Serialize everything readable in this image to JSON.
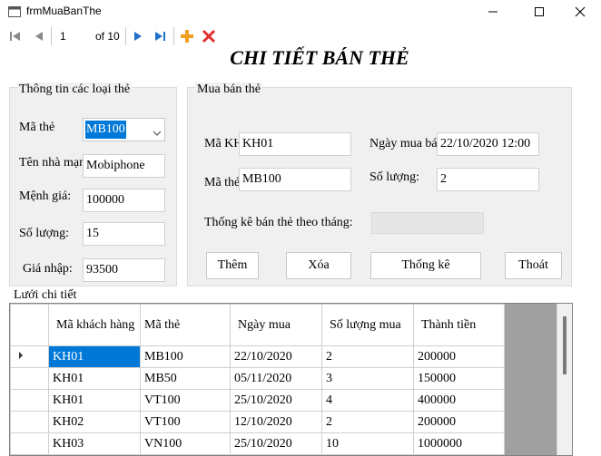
{
  "window": {
    "title": "frmMuaBanThe",
    "minimize_icon": "minimize-icon",
    "maximize_icon": "maximize-icon",
    "close_icon": "close-icon"
  },
  "navigator": {
    "position": "1",
    "of_label": "of 10",
    "icons": [
      "move-first-icon",
      "move-previous-icon",
      "move-next-icon",
      "move-last-icon",
      "add-new-icon",
      "delete-icon"
    ]
  },
  "form_title": "CHI TIẾT BÁN THẺ",
  "card_info": {
    "title": "Thông tin các loại thẻ",
    "ma_the_label": "Mã thẻ",
    "ma_the_value": "MB100",
    "ten_nha_mang_label": "Tên nhà mạng",
    "ten_nha_mang_value": "Mobiphone",
    "menh_gia_label": "Mệnh giá:",
    "menh_gia_value": "100000",
    "so_luong_label": "Số lượng:",
    "so_luong_value": "15",
    "gia_nhap_label": "Giá nhập:",
    "gia_nhap_value": "93500"
  },
  "sale": {
    "title": "Mua bán thẻ",
    "ma_kh_label": "Mã KH",
    "ma_kh_value": "KH01",
    "ma_the_label": "Mã thẻ",
    "ma_the_value": "MB100",
    "ngay_mua_label": "Ngày mua bán",
    "ngay_mua_value": "22/10/2020 12:00",
    "so_luong_label": "Số lượng:",
    "so_luong_value": "2",
    "thong_ke_label": "Thống kê bán thẻ theo tháng:",
    "thong_ke_value": "",
    "buttons": {
      "them": "Thêm",
      "xoa": "Xóa",
      "thong_ke": "Thống kê",
      "thoat": "Thoát"
    }
  },
  "grid": {
    "title": "Lưới chi tiết",
    "columns": [
      "Mã khách hàng",
      "Mã thẻ",
      "Ngày mua",
      "Số lượng mua",
      "Thành tiền"
    ],
    "rows": [
      [
        "KH01",
        "MB100",
        "22/10/2020",
        "2",
        "200000"
      ],
      [
        "KH01",
        "MB50",
        "05/11/2020",
        "3",
        "150000"
      ],
      [
        "KH01",
        "VT100",
        "25/10/2020",
        "4",
        "400000"
      ],
      [
        "KH02",
        "VT100",
        "12/10/2020",
        "2",
        "200000"
      ],
      [
        "KH03",
        "VN100",
        "25/10/2020",
        "10",
        "1000000"
      ]
    ],
    "selected_row": 0
  },
  "colors": {
    "selection": "#0078d7",
    "nav_blue": "#1e70c8",
    "add_orange": "#f0a020",
    "delete_red": "#e03030"
  }
}
